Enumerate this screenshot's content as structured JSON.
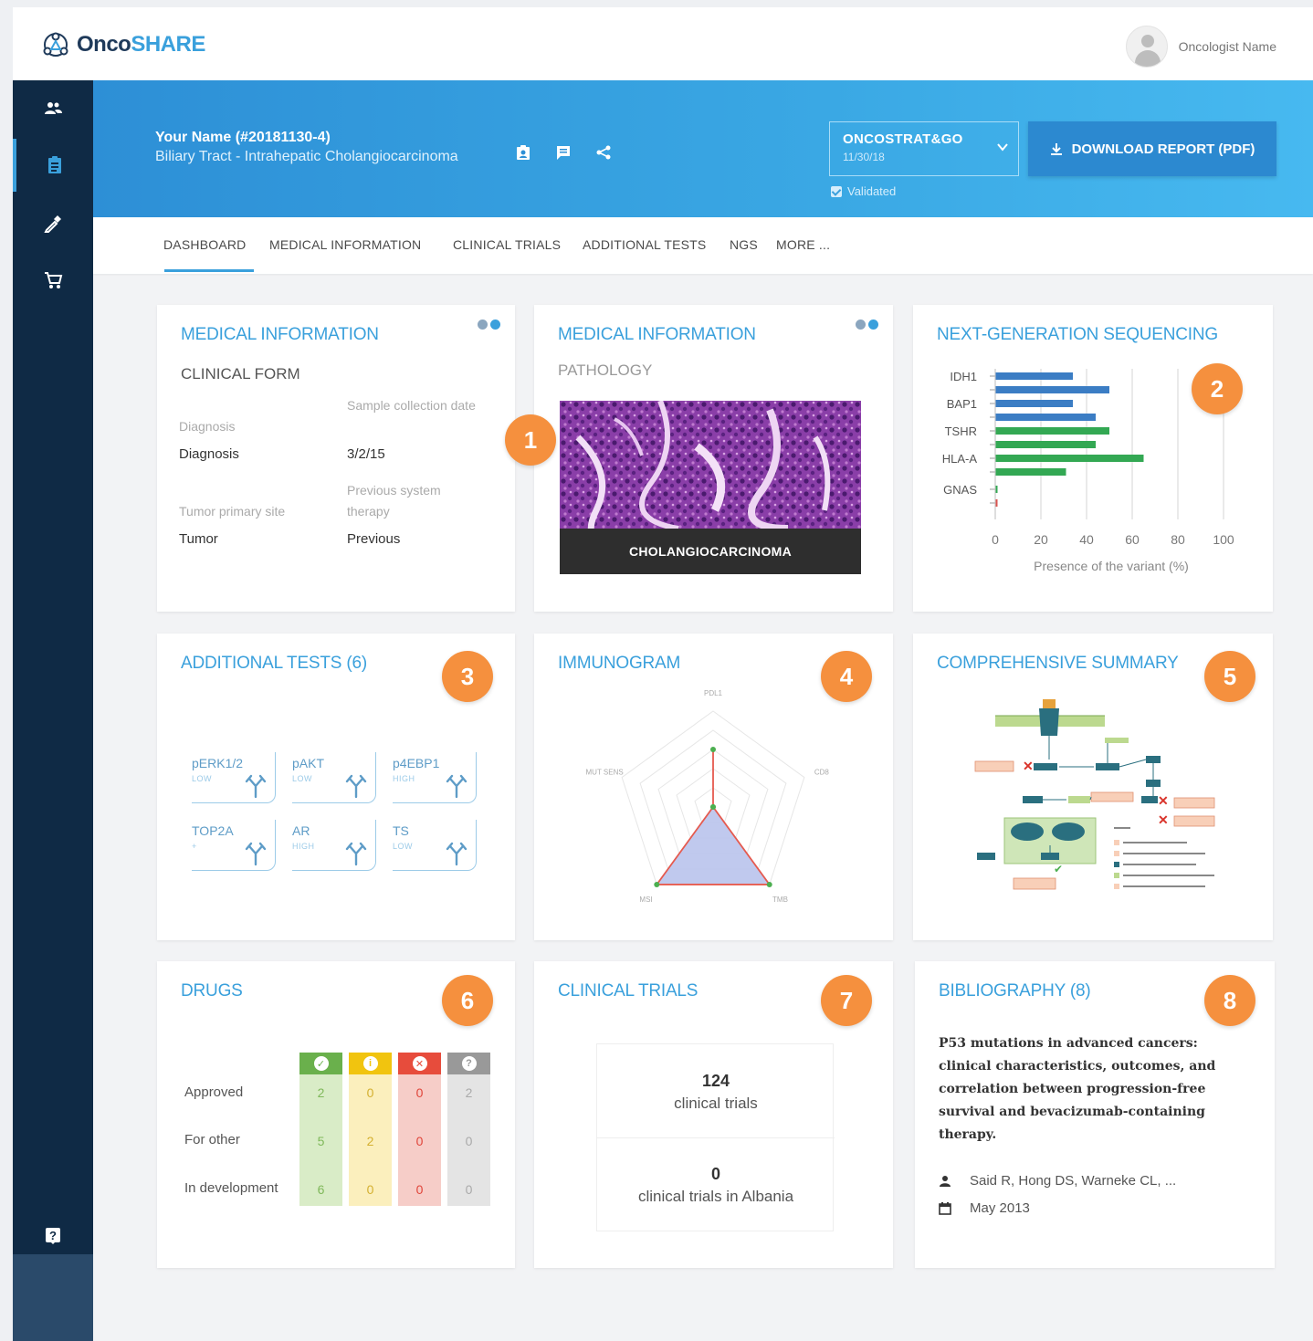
{
  "header": {
    "brand_prefix": "Onco",
    "brand_suffix": "SHARE",
    "user_name": "Oncologist Name"
  },
  "patient": {
    "name": "Your Name (#20181130-4)",
    "diagnosis": "Biliary Tract - Intrahepatic Cholangiocarcinoma"
  },
  "report": {
    "selected": "ONCOSTRAT&GO",
    "date": "11/30/18",
    "validated_label": "Validated",
    "download_label": "DOWNLOAD REPORT (PDF)"
  },
  "tabs": [
    "DASHBOARD",
    "MEDICAL INFORMATION",
    "CLINICAL TRIALS",
    "ADDITIONAL TESTS",
    "NGS",
    "MORE ..."
  ],
  "cards": {
    "clinical": {
      "title": "MEDICAL INFORMATION",
      "subtitle": "CLINICAL FORM",
      "fields": [
        {
          "label": "Diagnosis",
          "value": "Diagnosis"
        },
        {
          "label": "Sample collection date",
          "value": "3/2/15"
        },
        {
          "label": "Tumor primary site",
          "value": "Tumor"
        },
        {
          "label": "Previous system therapy",
          "value": "Previous"
        }
      ]
    },
    "pathology": {
      "title": "MEDICAL INFORMATION",
      "subtitle": "PATHOLOGY",
      "caption": "CHOLANGIOCARCINOMA"
    },
    "ngs": {
      "title": "NEXT-GENERATION SEQUENCING",
      "xlabel": "Presence of the variant (%)",
      "ticks": [
        "0",
        "20",
        "40",
        "60",
        "80",
        "100"
      ]
    },
    "additional": {
      "title": "ADDITIONAL TESTS  (6)",
      "tests": [
        {
          "name": "pERK1/2",
          "level": "LOW"
        },
        {
          "name": "pAKT",
          "level": "LOW"
        },
        {
          "name": "p4EBP1",
          "level": "HIGH"
        },
        {
          "name": "TOP2A",
          "level": "+"
        },
        {
          "name": "AR",
          "level": "HIGH"
        },
        {
          "name": "TS",
          "level": "LOW"
        }
      ]
    },
    "immunogram": {
      "title": "IMMUNOGRAM",
      "axes": [
        "PDL1",
        "CD8",
        "TMB",
        "MSI",
        "MUT SENS"
      ]
    },
    "summary": {
      "title": "COMPREHENSIVE SUMMARY"
    },
    "drugs": {
      "title": "DRUGS",
      "rows": [
        "Approved",
        "For other",
        "In development"
      ],
      "columns": [
        {
          "icon": "check-icon",
          "head": "#6ab04c",
          "fill": "#d9ecc7",
          "text": "#7fb85a",
          "values": [
            "2",
            "5",
            "6"
          ]
        },
        {
          "icon": "info-icon",
          "head": "#f1c40f",
          "fill": "#fbefbd",
          "text": "#d4b030",
          "values": [
            "0",
            "2",
            "0"
          ]
        },
        {
          "icon": "cross-icon",
          "head": "#e74c3c",
          "fill": "#f6cdc8",
          "text": "#e0453a",
          "values": [
            "0",
            "0",
            "0"
          ]
        },
        {
          "icon": "question-icon",
          "head": "#999999",
          "fill": "#e4e4e4",
          "text": "#aaaaaa",
          "values": [
            "2",
            "0",
            "0"
          ]
        }
      ]
    },
    "trials": {
      "title": "CLINICAL TRIALS",
      "count": "124",
      "count_label": "clinical trials",
      "local_count": "0",
      "local_label": "clinical trials in Albania"
    },
    "bibliography": {
      "title": "BIBLIOGRAPHY (8)",
      "paper": "P53 mutations in advanced cancers: clinical characteristics, outcomes, and correlation between progression-free survival and bevacizumab-containing therapy.",
      "authors": "Said R, Hong DS, Warneke CL, ...",
      "date": "May 2013"
    }
  },
  "badges": [
    "1",
    "2",
    "3",
    "4",
    "5",
    "6",
    "7",
    "8"
  ],
  "chart_data": {
    "type": "bar",
    "orientation": "horizontal",
    "categories": [
      "IDH1",
      "",
      "BAP1",
      "",
      "TSHR",
      "",
      "HLA-A",
      "",
      "GNAS",
      ""
    ],
    "values": [
      34,
      50,
      34,
      44,
      50,
      44,
      65,
      31,
      1,
      1
    ],
    "colors": [
      "#3b7dc4",
      "#3b7dc4",
      "#3b7dc4",
      "#3b7dc4",
      "#33a853",
      "#33a853",
      "#33a853",
      "#33a853",
      "#33a853",
      "#d9534f"
    ],
    "xlabel": "Presence of the variant (%)",
    "xlim": [
      0,
      100
    ],
    "grid": true
  },
  "immunogram_data": {
    "type": "radar",
    "axes": [
      "PDL1",
      "CD8",
      "TMB",
      "MSI",
      "MUT SENS"
    ],
    "values": [
      0.6,
      0.0,
      1.0,
      1.0,
      0.0
    ]
  }
}
